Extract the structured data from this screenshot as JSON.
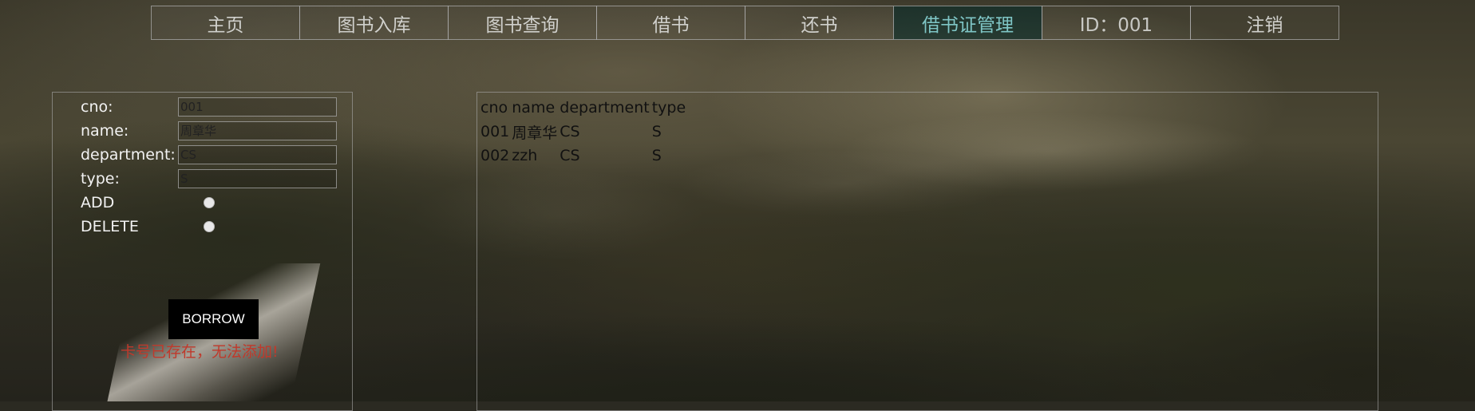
{
  "nav": {
    "items": [
      "主页",
      "图书入库",
      "图书查询",
      "借书",
      "还书",
      "借书证管理",
      "ID：001",
      "注销"
    ],
    "active_index": 5
  },
  "form": {
    "labels": {
      "cno": "cno:",
      "name": "name:",
      "department": "department:",
      "type": "type:",
      "add": "ADD",
      "delete": "DELETE"
    },
    "values": {
      "cno": "001",
      "name": "周章华",
      "department": "CS",
      "type": "S"
    },
    "button": "BORROW",
    "error": "卡号已存在，无法添加!"
  },
  "table": {
    "headers": [
      "cno",
      "name",
      "department",
      "type"
    ],
    "rows": [
      [
        "001",
        "周章华",
        "CS",
        "S"
      ],
      [
        "002",
        "zzh",
        "CS",
        "S"
      ]
    ]
  },
  "colors": {
    "active_nav": "#7fc6c6",
    "error": "#c0392b"
  }
}
